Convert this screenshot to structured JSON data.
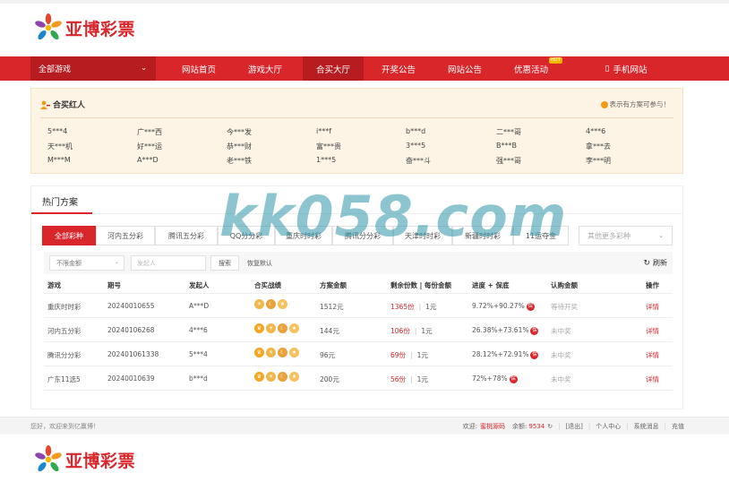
{
  "brand": {
    "logo_text": "亚博彩票",
    "red": "#d8262b",
    "dark_red": "#b71c21"
  },
  "nav": {
    "all_games": "全部游戏",
    "items": [
      "网站首页",
      "游戏大厅",
      "合买大厅",
      "开奖公告",
      "网站公告",
      "优惠活动",
      "手机网站"
    ],
    "active": "合买大厅",
    "hot_badge": "HOT"
  },
  "hongren": {
    "title": "合买红人",
    "note": "表示有方案可参与！",
    "names": [
      [
        "5***4",
        "天***机",
        "M***M"
      ],
      [
        "广***西",
        "好***运",
        "A***D"
      ],
      [
        "今***发",
        "恭***财",
        "老***铁"
      ],
      [
        "i***f",
        "富***贵",
        "1***5"
      ],
      [
        "b***d",
        "3***5",
        "奋***斗"
      ],
      [
        "二***哥",
        "B***B",
        "强***哥"
      ],
      [
        "4***6",
        "拿***去",
        "李***明"
      ]
    ]
  },
  "plans": {
    "title": "热门方案",
    "tabs": [
      "全部彩种",
      "河内五分彩",
      "腾讯五分彩",
      "QQ分分彩",
      "重庆时时彩",
      "腾讯分分彩",
      "天津时时彩",
      "新疆时时彩",
      "11运夺金"
    ],
    "more_select": "其他更多彩种",
    "filter": {
      "amount_select": "不限金额",
      "initiator_placeholder": "发起人",
      "search_btn": "搜索",
      "reset": "恢复默认",
      "refresh": "刷新"
    },
    "columns": [
      "游戏",
      "期号",
      "发起人",
      "合买战绩",
      "方案金额",
      "剩余份数 | 每份金额",
      "进度 + 保底",
      "认购金额",
      "操作"
    ],
    "rows": [
      {
        "game": "重庆时时彩",
        "issue": "20240010655",
        "initiator": "A***D",
        "amount": "1512元",
        "remaining": "1365份",
        "per_share": "1元",
        "progress": "9.72%+90.27%",
        "bao": "保",
        "status": "等待开奖",
        "action": "详情"
      },
      {
        "game": "河内五分彩",
        "issue": "20240106268",
        "initiator": "4***6",
        "amount": "144元",
        "remaining": "106份",
        "per_share": "1元",
        "progress": "26.38%+73.61%",
        "bao": "保",
        "status": "未中奖",
        "action": "详情"
      },
      {
        "game": "腾讯分分彩",
        "issue": "202401061338",
        "initiator": "5***4",
        "amount": "96元",
        "remaining": "69份",
        "per_share": "1元",
        "progress": "28.12%+72.91%",
        "bao": "保",
        "status": "未中奖",
        "action": "详情"
      },
      {
        "game": "广东11选5",
        "issue": "20240010639",
        "initiator": "b***d",
        "amount": "200元",
        "remaining": "56份",
        "per_share": "1元",
        "progress": "72%+78%",
        "bao": "保",
        "status": "未中奖",
        "action": "详情"
      }
    ]
  },
  "footer": {
    "welcome": "您好，欢迎来到亿赢博！",
    "hello": "欢迎:",
    "user": "蜜桃源码",
    "balance_label": "余额:",
    "balance": "9534",
    "logout": "[退出]",
    "center": "个人中心",
    "messages": "系统消息",
    "recharge": "充值"
  },
  "watermark": "kk058.com"
}
